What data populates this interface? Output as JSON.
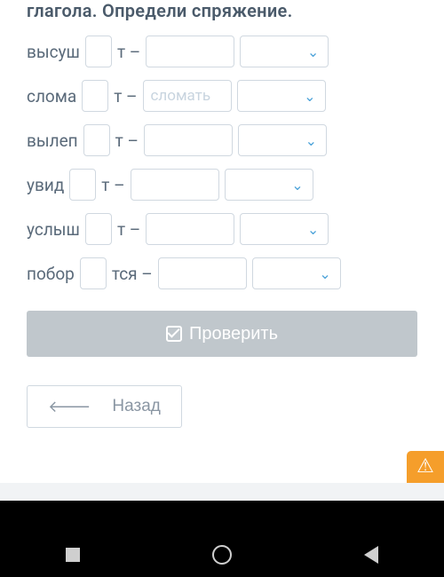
{
  "heading_partial": "глагола. Определи спряжение.",
  "rows": [
    {
      "stem": "высуш",
      "suffix": "т –",
      "mid_value": "",
      "faded": false
    },
    {
      "stem": "слома",
      "suffix": "т –",
      "mid_value": "сломать",
      "faded": true
    },
    {
      "stem": "вылеп",
      "suffix": "т –",
      "mid_value": "",
      "faded": false
    },
    {
      "stem": "увид",
      "suffix": "т –",
      "mid_value": "",
      "faded": false
    },
    {
      "stem": "услыш",
      "suffix": "т –",
      "mid_value": "",
      "faded": false
    },
    {
      "stem": "побор",
      "suffix": "тся –",
      "mid_value": "",
      "faded": false
    }
  ],
  "buttons": {
    "check": "Проверить",
    "back": "Назад"
  }
}
